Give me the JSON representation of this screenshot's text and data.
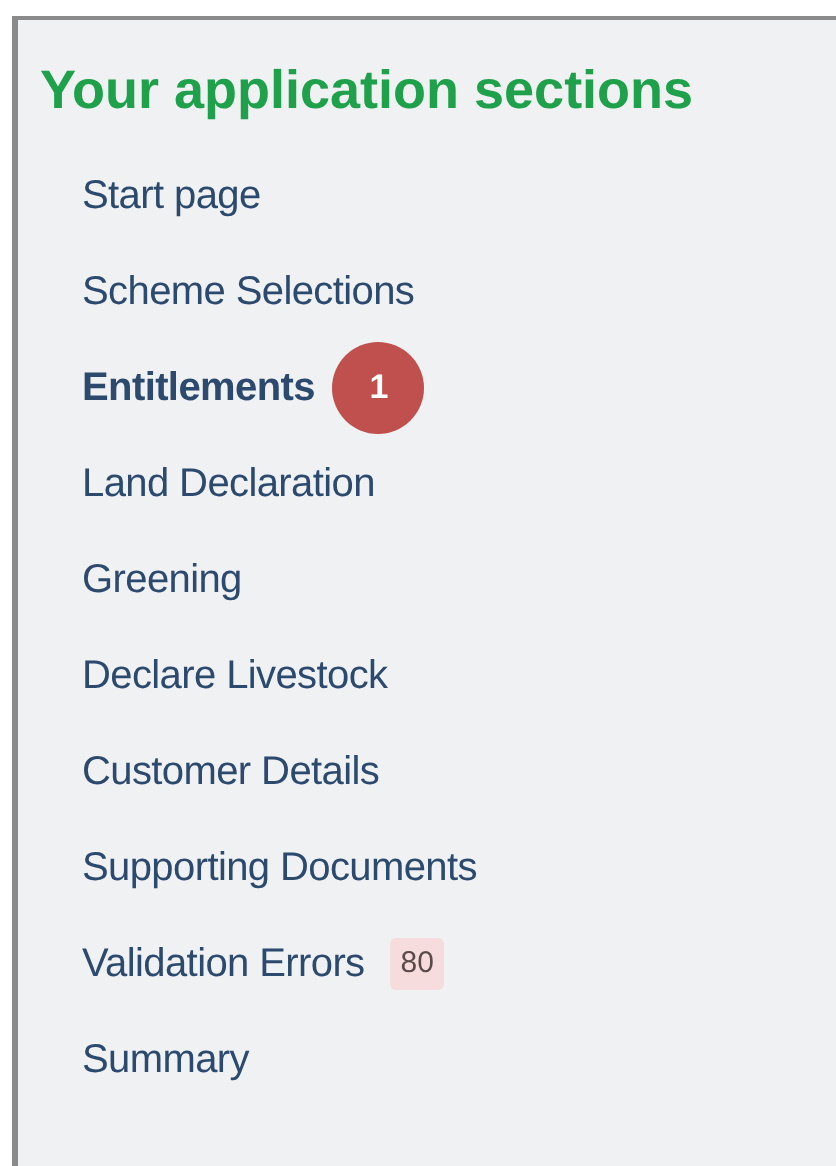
{
  "title": "Your application sections",
  "sections": [
    {
      "label": "Start page",
      "selected": false
    },
    {
      "label": "Scheme Selections",
      "selected": false
    },
    {
      "label": "Entitlements",
      "selected": true,
      "callout": "1"
    },
    {
      "label": "Land Declaration",
      "selected": false
    },
    {
      "label": "Greening",
      "selected": false
    },
    {
      "label": "Declare Livestock",
      "selected": false
    },
    {
      "label": "Customer Details",
      "selected": false
    },
    {
      "label": "Supporting Documents",
      "selected": false
    },
    {
      "label": "Validation Errors",
      "selected": false,
      "badge": "80"
    },
    {
      "label": "Summary",
      "selected": false
    }
  ]
}
